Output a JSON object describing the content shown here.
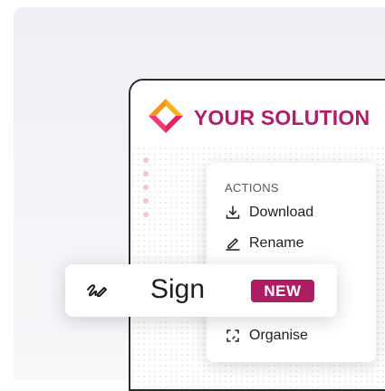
{
  "brand": {
    "title": "YOUR SOLUTION"
  },
  "actions_menu": {
    "heading": "ACTIONS",
    "items": [
      {
        "label": "Download",
        "icon": "download-icon"
      },
      {
        "label": "Rename",
        "icon": "rename-icon"
      },
      {
        "label": "Organise",
        "icon": "organise-icon"
      }
    ]
  },
  "sign_feature": {
    "label": "Sign",
    "badge": "NEW",
    "icon": "sign-icon"
  },
  "colors": {
    "accent": "#ad1d63",
    "brand_text": "#b01e68"
  }
}
